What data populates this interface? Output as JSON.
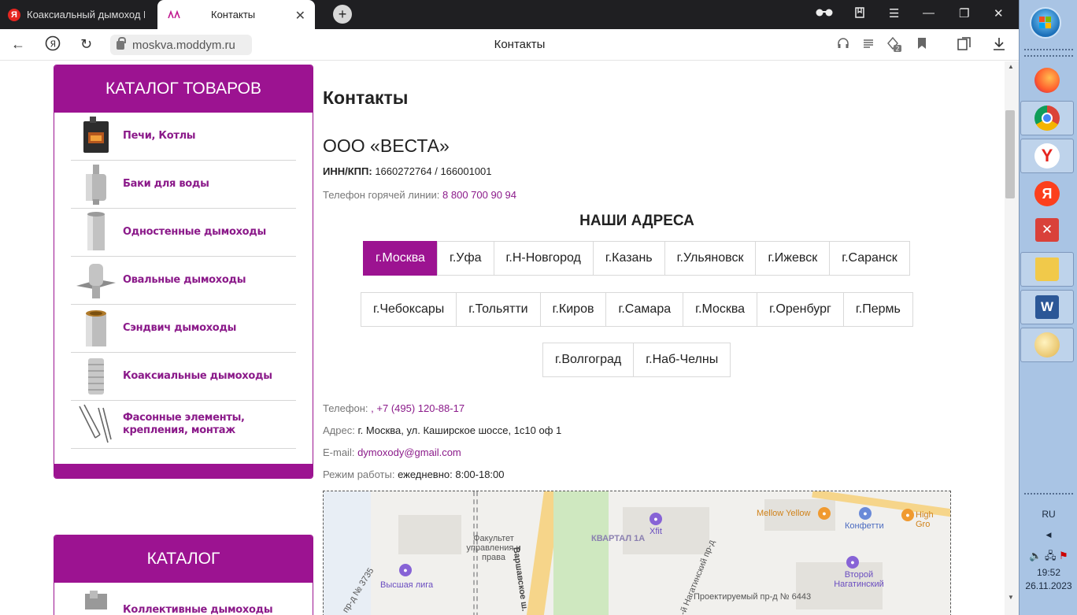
{
  "browser": {
    "tabs": [
      {
        "title": "Коаксиальный дымоход В",
        "favicon": "Я",
        "active": false
      },
      {
        "title": "Контакты",
        "favicon": "logo",
        "active": true
      }
    ],
    "url": "moskva.moddym.ru",
    "page_title": "Контакты",
    "tab_count_badge": "2"
  },
  "sidebar": {
    "catalog_title": "КАТАЛОГ ТОВАРОВ",
    "items": [
      {
        "label": "Печи, Котлы",
        "icon": "stove-icon"
      },
      {
        "label": "Баки для воды",
        "icon": "water-tank-icon"
      },
      {
        "label": "Одностенные дымоходы",
        "icon": "single-pipe-icon"
      },
      {
        "label": "Овальные дымоходы",
        "icon": "oval-pipe-icon"
      },
      {
        "label": "Сэндвич дымоходы",
        "icon": "sandwich-pipe-icon"
      },
      {
        "label": "Коаксиальные дымоходы",
        "icon": "coaxial-pipe-icon"
      },
      {
        "label": "Фасонные элементы, крепления, монтаж",
        "icon": "bracket-icon"
      }
    ],
    "catalog2_title": "КАТАЛОГ",
    "catalog2_first_item": "Коллективные дымоходы"
  },
  "main": {
    "heading": "Контакты",
    "company": "ООО «ВЕСТА»",
    "inn_label": "ИНН/КПП:",
    "inn_value": "1660272764 / 166001001",
    "hotline_label": "Телефон горячей линии:",
    "hotline_value": "8 800 700 90 94",
    "addresses_heading": "НАШИ АДРЕСА",
    "city_rows": [
      [
        "г.Москва",
        "г.Уфа",
        "г.Н-Новгород",
        "г.Казань",
        "г.Ульяновск",
        "г.Ижевск",
        "г.Саранск"
      ],
      [
        "г.Чебоксары",
        "г.Тольятти",
        "г.Киров",
        "г.Самара",
        "г.Москва",
        "г.Оренбург",
        "г.Пермь"
      ],
      [
        "г.Волгоград",
        "г.Наб-Челны"
      ]
    ],
    "active_city": "г.Москва",
    "phone_label": "Телефон:",
    "phone_value": ", +7 (495) 120-88-17",
    "address_label": "Адрес:",
    "address_value": "г. Москва, ул. Каширское шоссе, 1с10 оф 1",
    "email_label": "E-mail:",
    "email_value": "dymoxody@gmail.com",
    "hours_label": "Режим работы:",
    "hours_value": "ежедневно: 8:00-18:00"
  },
  "map": {
    "labels": [
      "Факультет управления и права",
      "Высшая лига",
      "КВАРТАЛ 1А",
      "Xfit",
      "Mellow Yellow",
      "Конфетти",
      "High Gro",
      "Второй Нагатинский",
      "Варшавское ш.",
      "Проектируемый пр-д № 6443",
      "пр-д № 3735",
      "1-й Нагатинский пр-д"
    ]
  },
  "taskbar": {
    "language": "RU",
    "time": "19:52",
    "date": "26.11.2023"
  },
  "colors": {
    "brand": "#9c1391",
    "link": "#8b1a8a",
    "taskbar": "#a9c4e4"
  }
}
